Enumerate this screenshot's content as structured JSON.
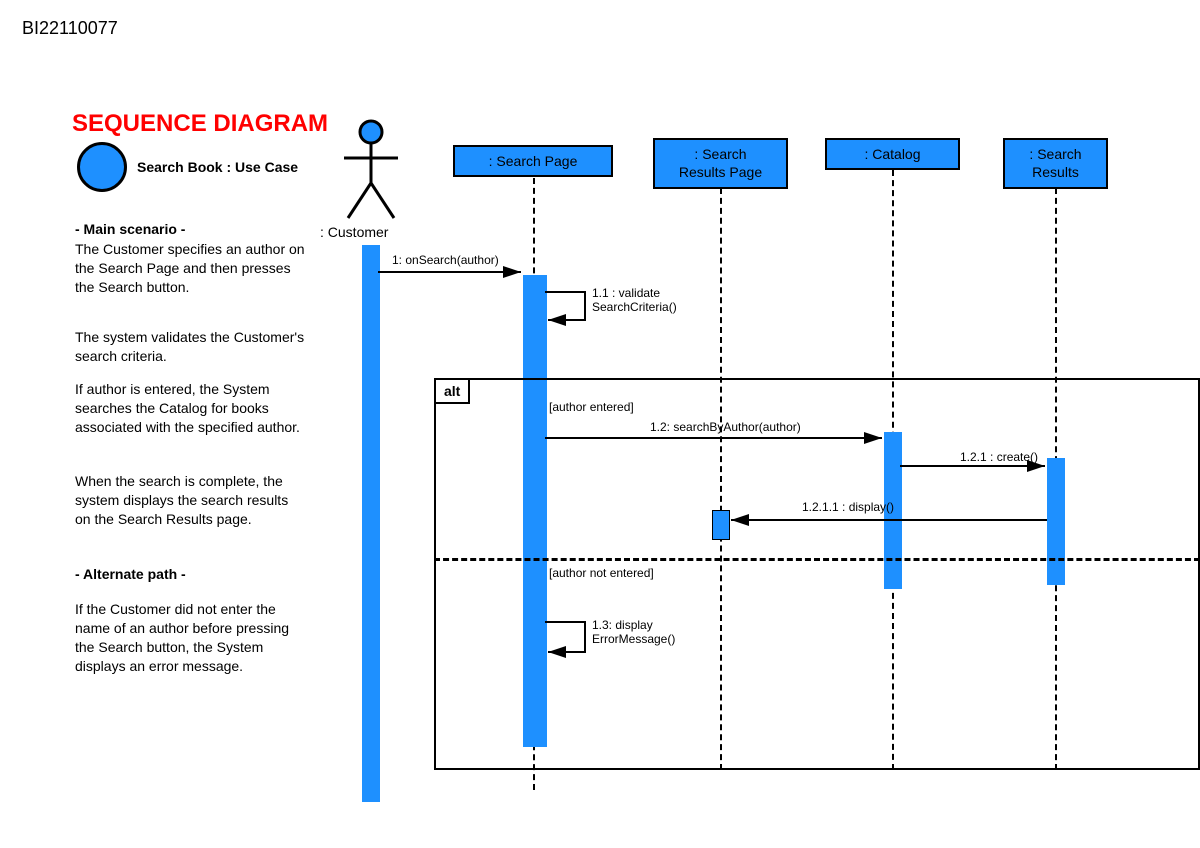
{
  "doc_id": "BI22110077",
  "title": "SEQUENCE DIAGRAM",
  "use_case_label": "Search Book : Use Case",
  "scenario": {
    "main_header": "- Main scenario -",
    "p1": "The Customer specifies an author on the Search Page and then presses the Search button.",
    "p2": "The system validates the Customer's search criteria.",
    "p3": "If author is entered, the System searches the Catalog for books associated with the specified author.",
    "p4": "When the search is complete, the system displays the search results on the Search Results page.",
    "alt_header": "- Alternate path -",
    "p5": "If the Customer did not enter the name of an author before pressing the Search button, the System displays an error message."
  },
  "actor_label": ": Customer",
  "lifelines": {
    "search_page": ": Search Page",
    "search_results_page_l1": ": Search",
    "search_results_page_l2": "Results Page",
    "catalog": ": Catalog",
    "search_results_l1": ": Search",
    "search_results_l2": "Results"
  },
  "messages": {
    "m1": "1: onSearch(author)",
    "m11_l1": "1.1 : validate",
    "m11_l2": "SearchCriteria()",
    "m12": "1.2: searchByAuthor(author)",
    "m121": "1.2.1 : create()",
    "m1211": "1.2.1.1 : display()",
    "m13_l1": "1.3: display",
    "m13_l2": "ErrorMessage()"
  },
  "alt": {
    "tag": "alt",
    "guard1": "[author entered]",
    "guard2": "[author not entered]"
  }
}
